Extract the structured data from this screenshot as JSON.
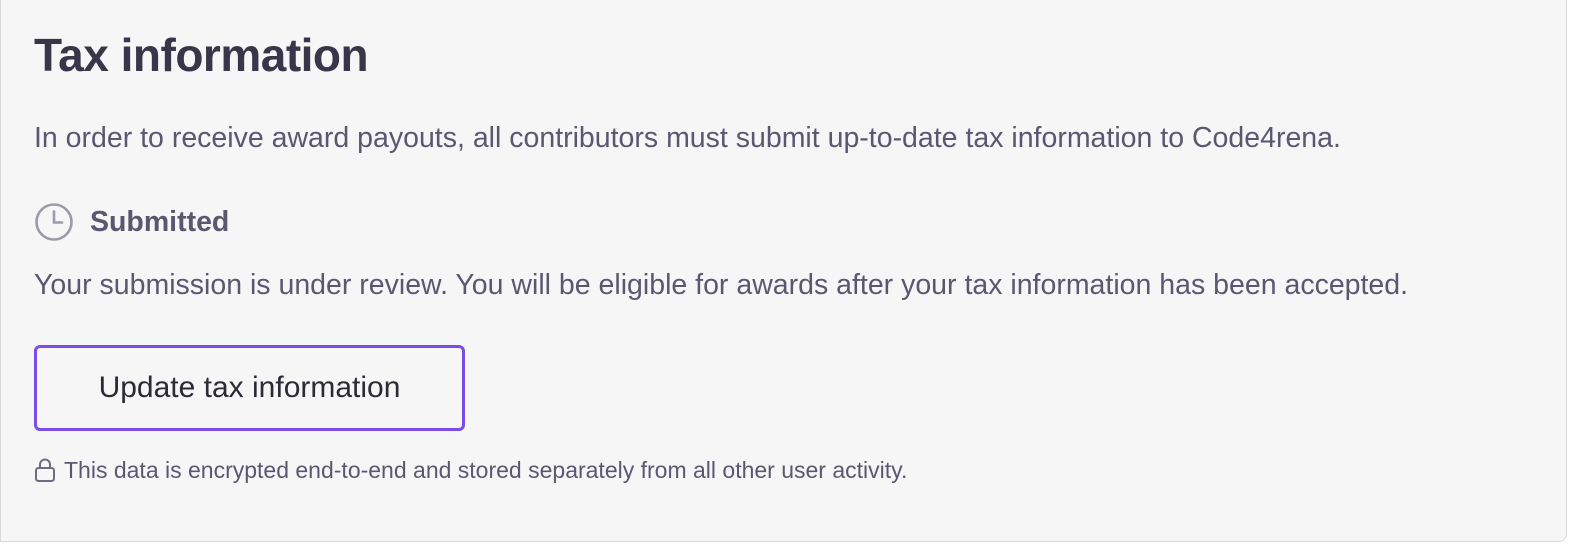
{
  "tax_section": {
    "title": "Tax information",
    "intro": "In order to receive award payouts, all contributors must submit up-to-date tax information to Code4rena.",
    "status": {
      "icon": "clock-icon",
      "label": "Submitted"
    },
    "review_message": "Your submission is under review. You will be eligible for awards after your tax information has been accepted.",
    "update_button": {
      "label": "Update tax information",
      "border_color": "#7a4de6"
    },
    "footnote": {
      "icon": "lock-icon",
      "text": "This data is encrypted end-to-end and stored separately from all other user activity."
    }
  }
}
